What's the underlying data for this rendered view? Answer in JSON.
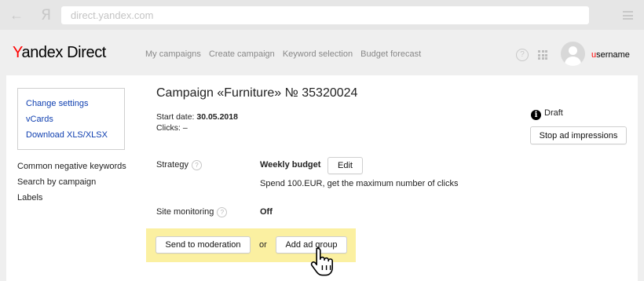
{
  "browser": {
    "url": "direct.yandex.com",
    "back_glyph": "←",
    "yandex_glyph": "Я"
  },
  "header": {
    "logo_first_letter": "Y",
    "logo_rest": "andex Direct",
    "nav": [
      "My campaigns",
      "Create campaign",
      "Keyword selection",
      "Budget forecast"
    ],
    "help_glyph": "?",
    "username_first": "u",
    "username_rest": "sername"
  },
  "sidebar": {
    "box_links": [
      "Change settings",
      "vCards",
      "Download XLS/XLSX"
    ],
    "links": [
      "Common negative keywords",
      "Search by campaign",
      "Labels"
    ]
  },
  "campaign": {
    "title": "Campaign «Furniture» № 35320024",
    "start_date_label": "Start date:",
    "start_date_value": "30.05.2018",
    "clicks_label": "Clicks:",
    "clicks_value": "–"
  },
  "status": {
    "label": "Draft",
    "info_glyph": "i",
    "stop_button": "Stop ad impressions"
  },
  "strategy": {
    "label": "Strategy",
    "value": "Weekly budget",
    "edit_button": "Edit",
    "description": "Spend 100.EUR, get the maximum number of clicks"
  },
  "monitoring": {
    "label": "Site monitoring",
    "value": "Off"
  },
  "actions": {
    "send_button": "Send to moderation",
    "or_text": "or",
    "add_button": "Add ad group"
  },
  "colors": {
    "accent_red": "#ff0000",
    "link_blue": "#0f3fb0",
    "highlight_yellow": "#fbf0a1"
  },
  "icons": [
    "back-arrow-icon",
    "yandex-icon",
    "menu-icon",
    "help-icon",
    "apps-grid-icon",
    "avatar",
    "info-icon",
    "question-icon",
    "hand-cursor-icon"
  ]
}
